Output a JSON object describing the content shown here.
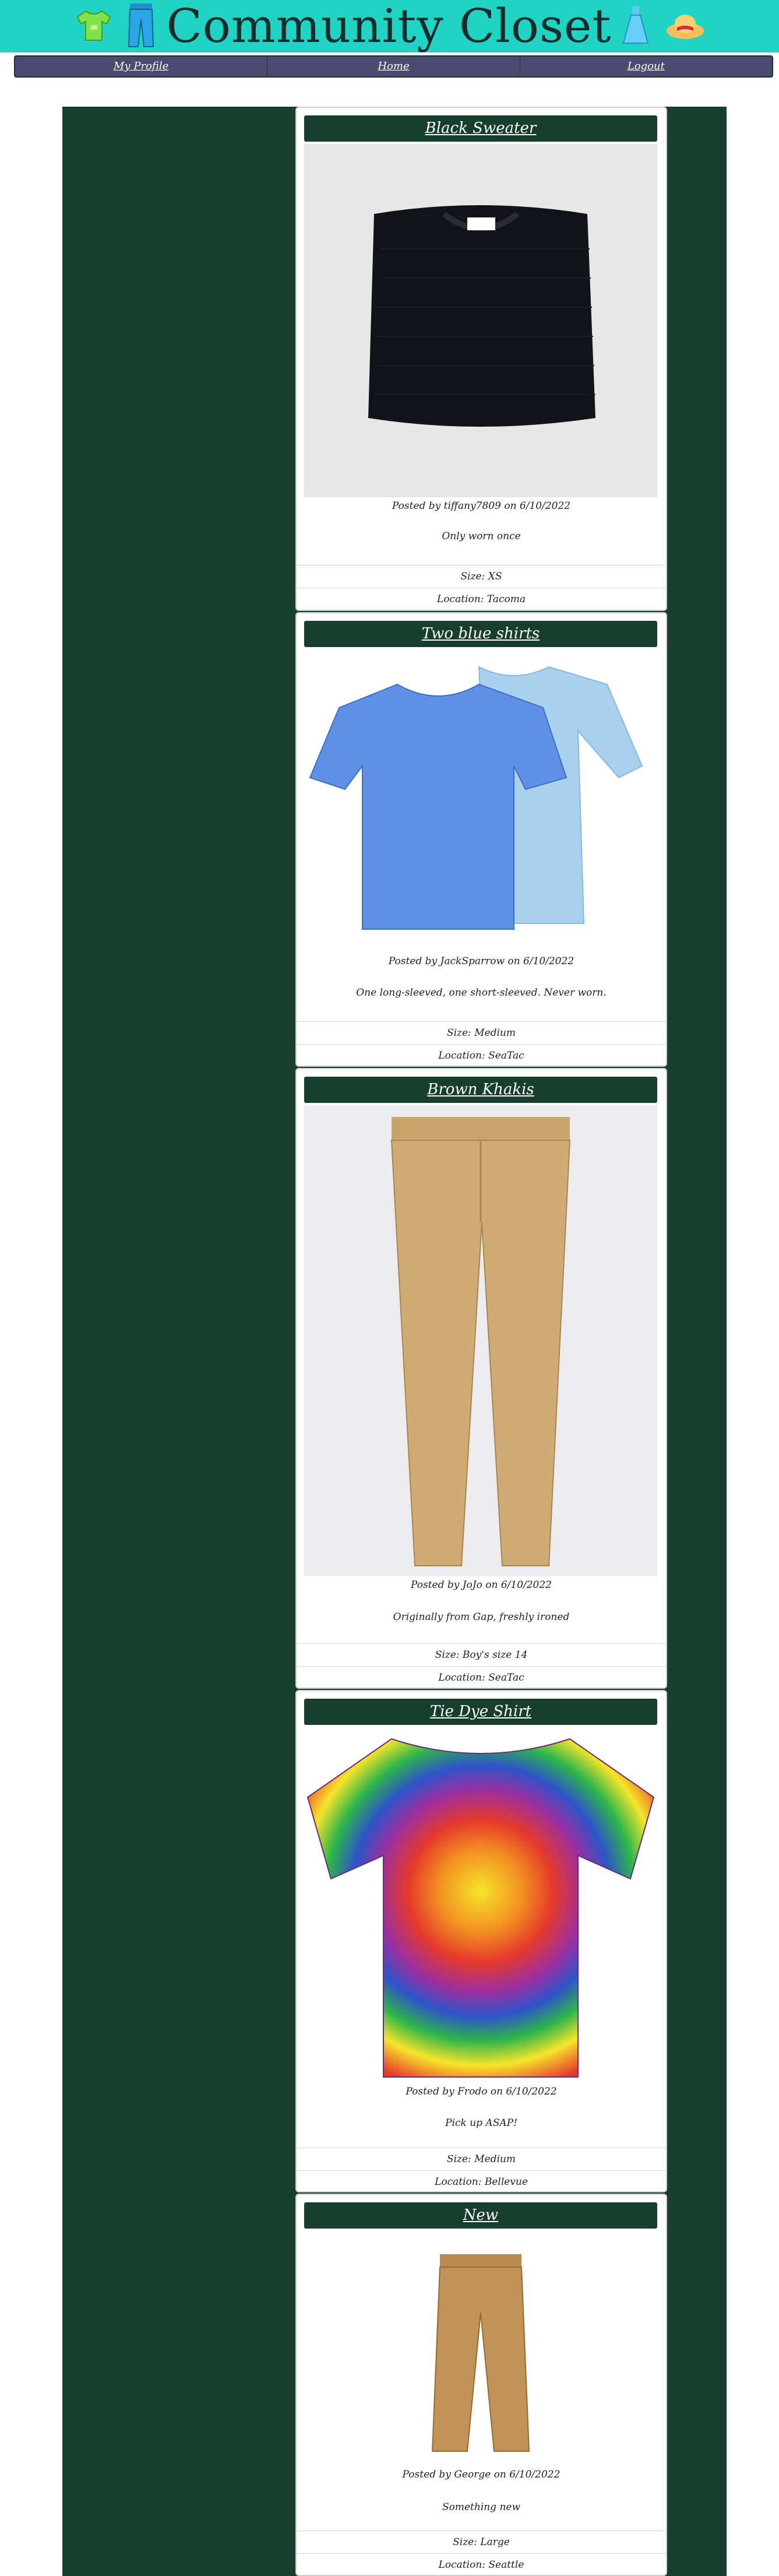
{
  "header": {
    "title": "Community Closet",
    "icons": [
      "tshirt-icon",
      "jeans-icon",
      "dress-icon",
      "hat-icon"
    ]
  },
  "nav": {
    "profile": "My Profile",
    "home": "Home",
    "logout": "Logout"
  },
  "posts": [
    {
      "title": "Black Sweater",
      "posted": "Posted by tiffany7809 on 6/10/2022",
      "desc": "Only worn once",
      "size": "Size: XS",
      "location": "Location: Tacoma",
      "image": "black-sweater-image"
    },
    {
      "title": "Two blue shirts",
      "posted": "Posted by JackSparrow on 6/10/2022",
      "desc": "One long-sleeved, one short-sleeved. Never worn.",
      "size": "Size: Medium",
      "location": "Location: SeaTac",
      "image": "blue-shirts-image"
    },
    {
      "title": "Brown Khakis",
      "posted": "Posted by JoJo on 6/10/2022",
      "desc": "Originally from Gap, freshly ironed",
      "size": "Size: Boy's size 14",
      "location": "Location: SeaTac",
      "image": "khakis-image"
    },
    {
      "title": "Tie Dye Shirt",
      "posted": "Posted by Frodo on 6/10/2022",
      "desc": "Pick up ASAP!",
      "size": "Size: Medium",
      "location": "Location: Bellevue",
      "image": "tie-dye-image"
    },
    {
      "title": "New",
      "posted": "Posted by George on 6/10/2022",
      "desc": "Something new",
      "size": "Size: Large",
      "location": "Location: Seattle",
      "image": "pants-image"
    }
  ],
  "colors": {
    "header_bg": "#20d3c2",
    "nav_bg": "#4b4b70",
    "band_bg": "#183e2e",
    "card_title_bg": "#183e2e"
  }
}
